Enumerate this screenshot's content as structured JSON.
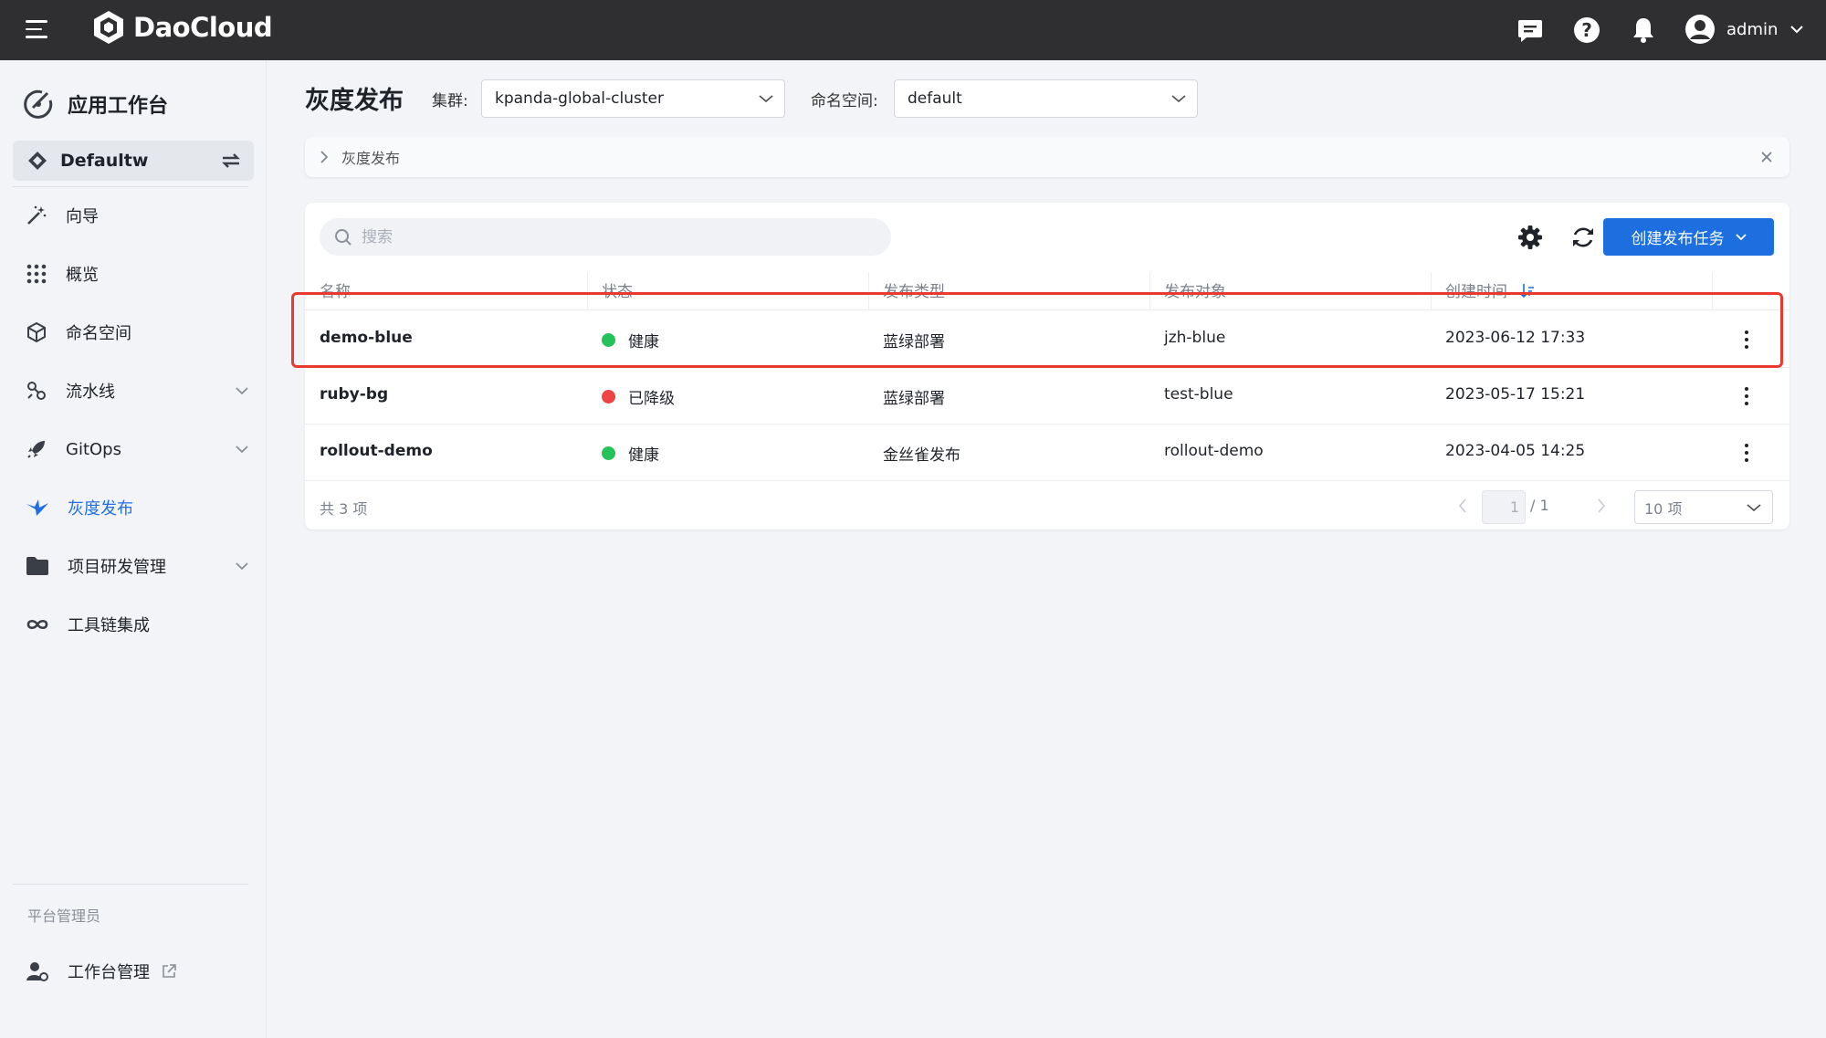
{
  "topbar": {
    "brand": "DaoCloud",
    "user_name": "admin"
  },
  "sidebar": {
    "app_title": "应用工作台",
    "workspace": "Defaultw",
    "items": [
      {
        "label": "向导",
        "icon": "wand-icon"
      },
      {
        "label": "概览",
        "icon": "grid-icon"
      },
      {
        "label": "命名空间",
        "icon": "cube-icon"
      },
      {
        "label": "流水线",
        "icon": "pipeline-icon",
        "expandable": true
      },
      {
        "label": "GitOps",
        "icon": "rocket-icon",
        "expandable": true
      },
      {
        "label": "灰度发布",
        "icon": "bird-icon",
        "active": true
      },
      {
        "label": "项目研发管理",
        "icon": "folder-icon",
        "expandable": true
      },
      {
        "label": "工具链集成",
        "icon": "infinity-icon"
      }
    ],
    "section_label": "平台管理员",
    "admin_item": "工作台管理"
  },
  "page": {
    "title": "灰度发布",
    "cluster_label": "集群:",
    "cluster_value": "kpanda-global-cluster",
    "namespace_label": "命名空间:",
    "namespace_value": "default",
    "breadcrumb": "灰度发布"
  },
  "toolbar": {
    "search_placeholder": "搜索",
    "create_label": "创建发布任务"
  },
  "table": {
    "columns": [
      "名称",
      "状态",
      "发布类型",
      "发布对象",
      "创建时间"
    ],
    "rows": [
      {
        "name": "demo-blue",
        "status": "健康",
        "status_color": "#25c25a",
        "type": "蓝绿部署",
        "target": "jzh-blue",
        "created": "2023-06-12 17:33"
      },
      {
        "name": "ruby-bg",
        "status": "已降级",
        "status_color": "#ef4444",
        "type": "蓝绿部署",
        "target": "test-blue",
        "created": "2023-05-17 15:21"
      },
      {
        "name": "rollout-demo",
        "status": "健康",
        "status_color": "#25c25a",
        "type": "金丝雀发布",
        "target": "rollout-demo",
        "created": "2023-04-05 14:25"
      }
    ]
  },
  "pagination": {
    "total": "共 3 项",
    "current_page": "1",
    "page_total": "/ 1",
    "page_size": "10 项"
  },
  "colors": {
    "topbar": "#2f2f32",
    "accent": "#1d6fe0",
    "highlight": "#ea3a2f"
  }
}
